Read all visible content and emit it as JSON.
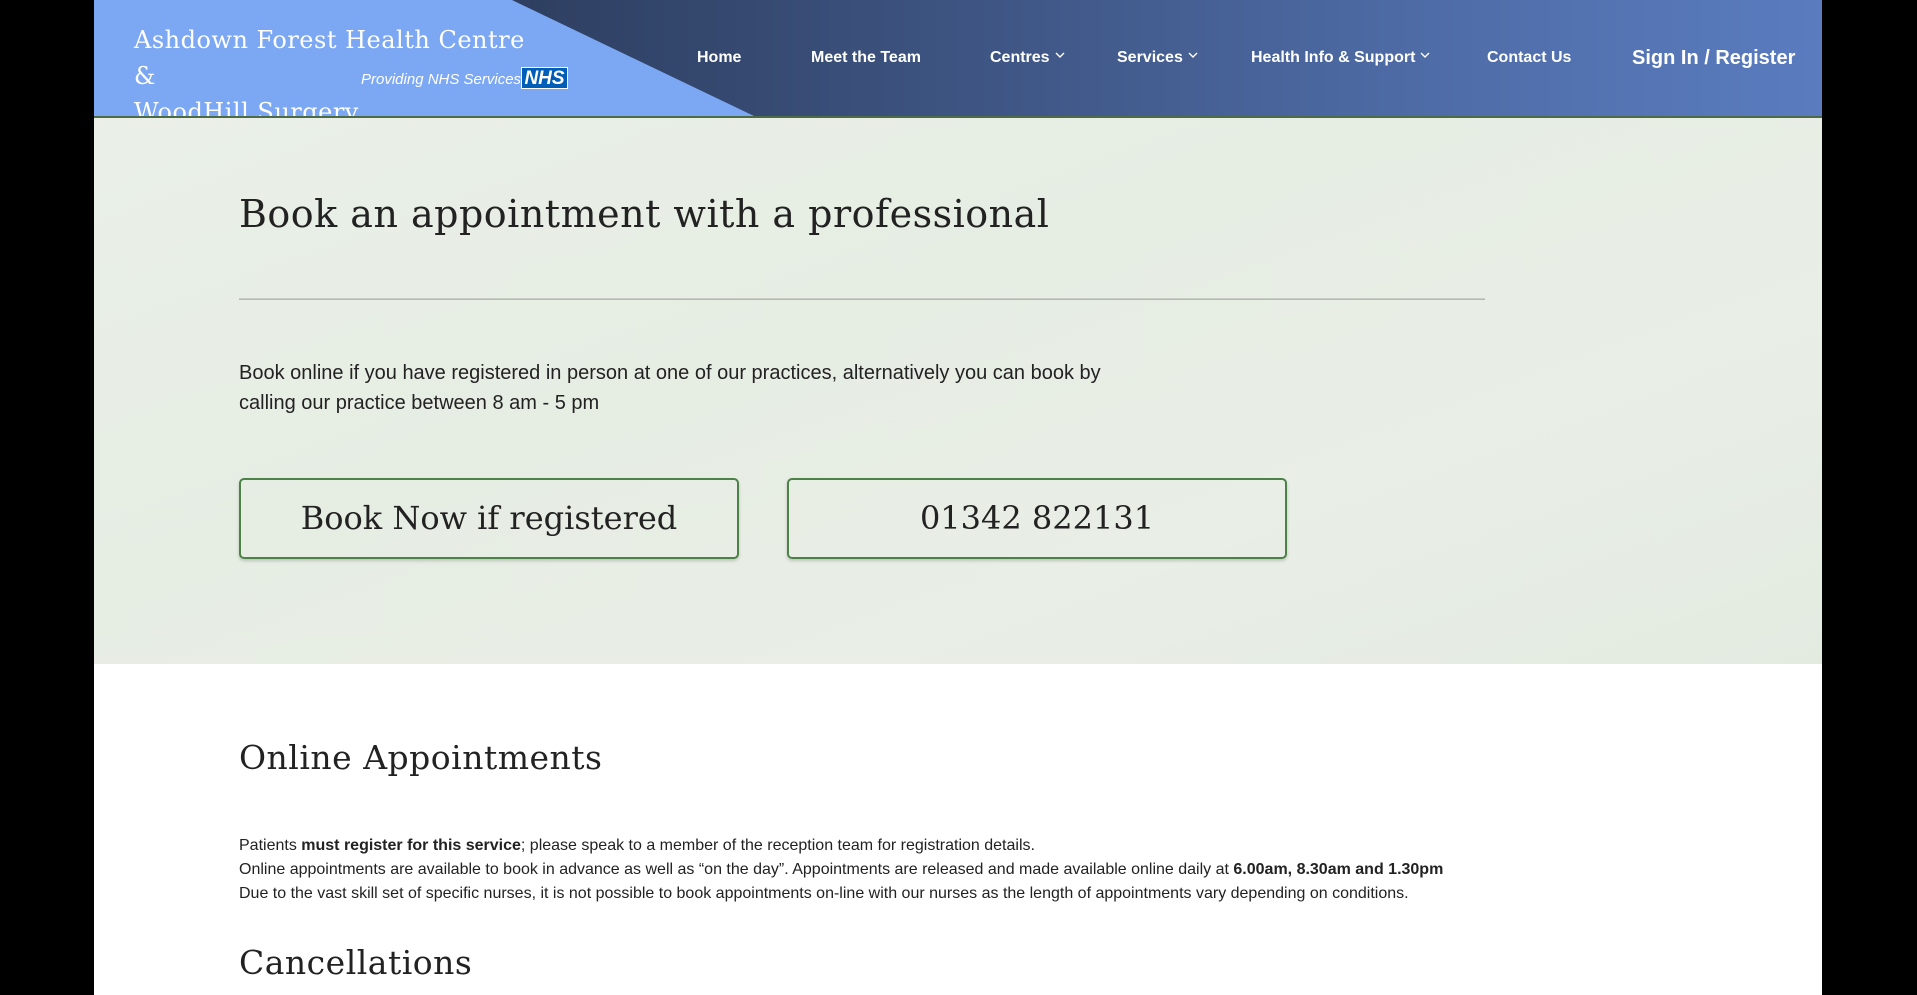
{
  "header": {
    "brand_line1": "Ashdown Forest Health Centre &",
    "brand_line2": "WoodHill Surgery",
    "tagline": "Providing NHS Services",
    "nhs_logo": "NHS",
    "colors": {
      "brand_panel": "#7ba7f3",
      "nav_start": "#1f2c44",
      "nav_end": "#5a7cbf",
      "nhs_blue": "#005eb8"
    }
  },
  "nav": {
    "home": "Home",
    "team": "Meet the Team",
    "centres": "Centres",
    "services": "Services",
    "health_info": "Health Info & Support",
    "contact": "Contact Us",
    "signin": "Sign In / Register",
    "dropdown_icon": "chevron-down-icon"
  },
  "hero": {
    "title": "Book an appointment with a professional",
    "text_line1": "Book online if you have registered in person at one of our practices, alternatively you can book by",
    "text_line2": "calling our practice between 8 am - 5 pm",
    "book_button": "Book Now if registered",
    "phone_button": "01342 822131",
    "colors": {
      "background": "#e8eee6",
      "button_border": "#4c8148"
    }
  },
  "online": {
    "title": "Online Appointments",
    "line1_pre": "Patients ",
    "line1_bold": "must register for this service",
    "line1_post": "; please speak to a member of the reception team for registration details.",
    "line2_pre": "Online appointments are available to book in advance as well as “on the day”. Appointments are released and made available online daily at ",
    "line2_bold": "6.00am, 8.30am and 1.30pm",
    "line3": "Due to the vast skill set of specific nurses, it is not possible to book appointments on-line with our nurses as the length of appointments vary depending on conditions."
  },
  "cancellations": {
    "title": "Cancellations"
  }
}
